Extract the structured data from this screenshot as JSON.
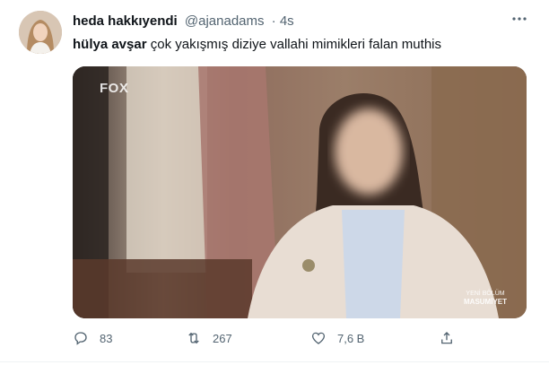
{
  "tweet": {
    "author": {
      "display_name": "heda hakkıyendi",
      "handle": "@ajanadams",
      "time": "· 4s"
    },
    "more_icon": "more-horizontal-icon",
    "text": {
      "mention": "hülya avşar",
      "body": " çok yakışmış diziye vallahi mimikleri falan muthis"
    },
    "media": {
      "channel_logo": "FOX",
      "badge_line1": "YENİ BÖLÜM",
      "badge_line2": "MASUMİYET"
    },
    "actions": {
      "reply": {
        "icon": "reply-icon",
        "count": "83"
      },
      "retweet": {
        "icon": "retweet-icon",
        "count": "267"
      },
      "like": {
        "icon": "heart-icon",
        "count": "7,6 B"
      },
      "share": {
        "icon": "share-icon"
      }
    }
  },
  "colors": {
    "text": "#0f1419",
    "secondary": "#536471",
    "divider": "#eff3f4"
  }
}
